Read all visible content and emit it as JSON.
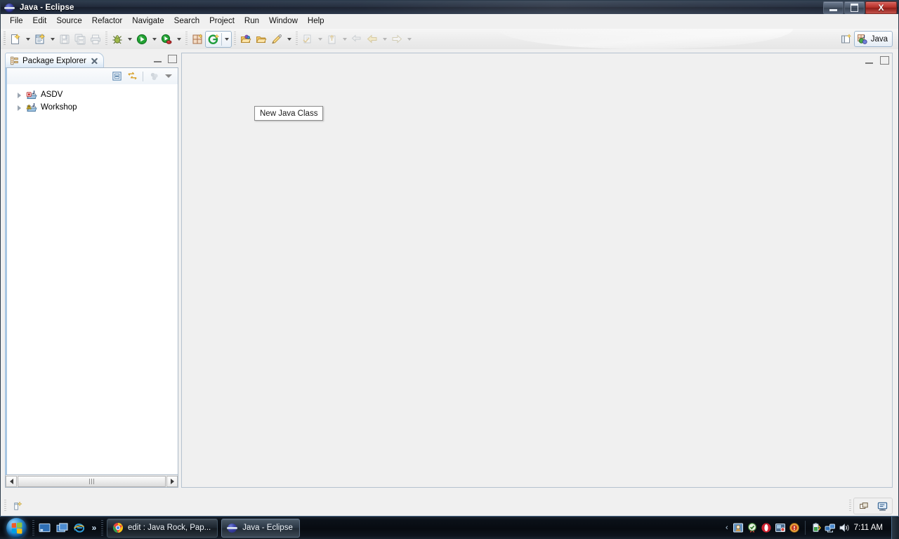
{
  "window": {
    "title": "Java - Eclipse",
    "icon": "eclipse-icon",
    "buttons": {
      "minimize": "minimize-button",
      "restore": "restore-button",
      "close": "X"
    }
  },
  "menubar": {
    "items": [
      {
        "label": "File"
      },
      {
        "label": "Edit"
      },
      {
        "label": "Source"
      },
      {
        "label": "Refactor"
      },
      {
        "label": "Navigate"
      },
      {
        "label": "Search"
      },
      {
        "label": "Project"
      },
      {
        "label": "Run"
      },
      {
        "label": "Window"
      },
      {
        "label": "Help"
      }
    ]
  },
  "toolbar": {
    "groups": [
      {
        "name": "new-group",
        "items": [
          {
            "icon": "new-wizard-icon",
            "dropdown": true,
            "enabled": true
          },
          {
            "icon": "new-java-class-icon",
            "dropdown": true,
            "enabled": true
          },
          {
            "icon": "save-icon",
            "dropdown": false,
            "enabled": false
          },
          {
            "icon": "save-all-icon",
            "dropdown": false,
            "enabled": false
          },
          {
            "icon": "print-icon",
            "dropdown": false,
            "enabled": false
          }
        ]
      },
      {
        "name": "launch-group",
        "items": [
          {
            "icon": "debug-icon",
            "dropdown": true,
            "enabled": true
          },
          {
            "icon": "run-icon",
            "dropdown": true,
            "enabled": true
          },
          {
            "icon": "external-tools-icon",
            "dropdown": true,
            "enabled": true
          }
        ]
      },
      {
        "name": "java-group",
        "items": [
          {
            "icon": "new-java-package-icon",
            "dropdown": false,
            "enabled": true
          },
          {
            "icon": "open-type-icon",
            "dropdown": true,
            "enabled": true
          }
        ]
      },
      {
        "name": "search-group",
        "items": [
          {
            "icon": "open-resource-icon",
            "dropdown": false,
            "enabled": true
          },
          {
            "icon": "open-folder-icon",
            "dropdown": false,
            "enabled": true
          },
          {
            "icon": "search-icon",
            "dropdown": true,
            "enabled": true
          }
        ]
      },
      {
        "name": "navigate-group",
        "items": [
          {
            "icon": "next-annotation-icon",
            "dropdown": true,
            "enabled": false
          },
          {
            "icon": "previous-annotation-icon",
            "dropdown": true,
            "enabled": false
          },
          {
            "icon": "last-edit-location-icon",
            "dropdown": false,
            "enabled": false
          },
          {
            "icon": "back-icon",
            "dropdown": true,
            "enabled": false
          },
          {
            "icon": "forward-icon",
            "dropdown": true,
            "enabled": false
          }
        ]
      }
    ],
    "perspective": {
      "open_perspective_icon": "open-perspective-icon",
      "active_label": "Java",
      "active_icon": "java-perspective-icon"
    }
  },
  "tooltip": {
    "text": "New Java Class",
    "visible": true
  },
  "package_explorer": {
    "tab": {
      "title": "Package Explorer",
      "icon": "package-explorer-icon",
      "close_icon": "close-icon"
    },
    "view_controls": {
      "minimize": "minimize-icon",
      "maximize": "maximize-icon"
    },
    "toolbar": [
      {
        "icon": "collapse-all-icon",
        "enabled": true
      },
      {
        "icon": "link-with-editor-icon",
        "enabled": true
      },
      {
        "icon": "focus-on-active-task-icon",
        "enabled": false
      },
      {
        "icon": "view-menu-icon",
        "enabled": true
      }
    ],
    "tree": [
      {
        "label": "ASDV",
        "icon": "java-project-icon",
        "marker": "error",
        "expanded": false
      },
      {
        "label": "Workshop",
        "icon": "java-project-icon",
        "marker": "warning",
        "expanded": false
      }
    ],
    "scrollbar": {
      "left_arrow": "scroll-left-icon",
      "right_arrow": "scroll-right-icon",
      "grip": "scrollbar-grip"
    }
  },
  "editor_area": {
    "empty": true,
    "controls": {
      "minimize": "minimize-icon",
      "maximize": "maximize-icon"
    }
  },
  "statusbar": {
    "left_icon": "build-progress-icon",
    "right_icons": [
      {
        "icon": "restore-views-icon"
      },
      {
        "icon": "show-console-icon"
      }
    ]
  },
  "taskbar": {
    "start": {
      "icon": "windows-start-orb"
    },
    "quicklaunch": [
      {
        "icon": "show-desktop-icon"
      },
      {
        "icon": "switch-windows-icon"
      },
      {
        "icon": "internet-explorer-icon"
      }
    ],
    "overflow_chevron": "»",
    "tasks": [
      {
        "label": "edit : Java Rock, Pap...",
        "icon": "chrome-icon",
        "active": false
      },
      {
        "label": "Java - Eclipse",
        "icon": "eclipse-icon",
        "active": true
      }
    ],
    "tray": {
      "chevron": "‹",
      "icons": [
        {
          "icon": "tray-app-icon"
        },
        {
          "icon": "tray-shield-icon"
        },
        {
          "icon": "tray-opera-icon"
        },
        {
          "icon": "tray-media-icon"
        },
        {
          "icon": "tray-alert-icon"
        },
        {
          "icon": "battery-icon"
        },
        {
          "icon": "network-icon"
        },
        {
          "icon": "volume-icon"
        }
      ]
    },
    "clock": "7:11 AM"
  }
}
